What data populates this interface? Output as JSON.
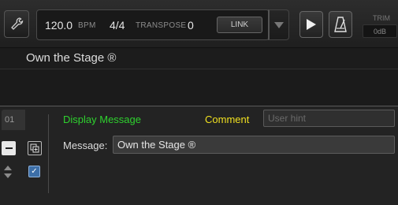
{
  "transport": {
    "tempo_value": "120.0",
    "tempo_unit": "BPM",
    "time_signature": "4/4",
    "transpose_label": "TRANSPOSE",
    "transpose_value": "0",
    "link_label": "LINK"
  },
  "trim": {
    "label": "TRIM",
    "value": "0dB"
  },
  "song": {
    "title": "Own the Stage ®"
  },
  "event": {
    "row_number": "01",
    "type_label": "Display Message",
    "comment_label": "Comment",
    "comment_placeholder": "User hint",
    "comment_value": "",
    "message_label": "Message:",
    "message_value": "Own the Stage ®",
    "enabled": true
  },
  "colors": {
    "event_type": "#2ed12e",
    "comment_label": "#f0e020",
    "checkbox": "#3d6fa8"
  },
  "icons": {
    "settings": "wrench-icon",
    "dropdown": "chevron-down-icon",
    "play": "play-icon",
    "metronome": "metronome-icon",
    "add": "add-icon",
    "remove": "minus-icon",
    "reorder": "drag-handle-icon"
  }
}
